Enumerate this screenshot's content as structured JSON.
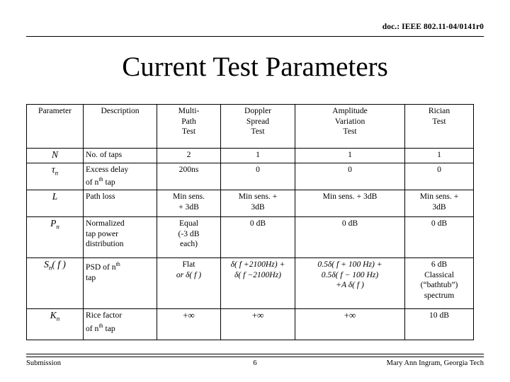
{
  "header": {
    "doc_id": "doc.: IEEE 802.11-04/0141r0"
  },
  "title": "Current Test Parameters",
  "table": {
    "columns": [
      {
        "key": "parameter",
        "label": "Parameter"
      },
      {
        "key": "description",
        "label": "Description"
      },
      {
        "key": "multipath",
        "label": "Multi-\nPath\nTest"
      },
      {
        "key": "doppler",
        "label": "Doppler\nSpread\nTest"
      },
      {
        "key": "amplitude",
        "label": "Amplitude\nVariation\nTest"
      },
      {
        "key": "rician",
        "label": "Rician\nTest"
      }
    ],
    "headers": {
      "parameter": "Parameter",
      "description": "Description",
      "multipath_l1": "Multi-",
      "multipath_l2": "Path",
      "multipath_l3": "Test",
      "doppler_l1": "Doppler",
      "doppler_l2": "Spread",
      "doppler_l3": "Test",
      "amplitude_l1": "Amplitude",
      "amplitude_l2": "Variation",
      "amplitude_l3": "Test",
      "rician_l1": "Rician",
      "rician_l2": "Test"
    },
    "rows": [
      {
        "symbol": "N",
        "symbol_sub": "",
        "description": "No. of taps",
        "multipath": "2",
        "doppler": "1",
        "amplitude": "1",
        "rician": "1"
      },
      {
        "symbol": "τ",
        "symbol_sub": "n",
        "description_a": "Excess delay",
        "description_b_pre": "of n",
        "description_b_sup": "th",
        "description_b_post": " tap",
        "multipath": "200ns",
        "doppler": "0",
        "amplitude": "0",
        "rician": "0"
      },
      {
        "symbol": "L",
        "symbol_sub": "",
        "description": "Path loss",
        "multipath_l1": "Min sens.",
        "multipath_l2": "+ 3dB",
        "doppler_l1": "Min sens. +",
        "doppler_l2": "3dB",
        "amplitude": "Min sens. + 3dB",
        "rician_l1": "Min sens. +",
        "rician_l2": "3dB"
      },
      {
        "symbol": "P",
        "symbol_sub": "n",
        "description_l1": "Normalized",
        "description_l2": "tap power",
        "description_l3": "distribution",
        "multipath_l1": "Equal",
        "multipath_l2": "(-3 dB",
        "multipath_l3": "each)",
        "doppler": "0 dB",
        "amplitude": "0 dB",
        "rician": "0 dB"
      },
      {
        "symbol": "S",
        "symbol_sub": "n",
        "symbol_arg": "( f )",
        "description_a_pre": "PSD of n",
        "description_a_sup": "th",
        "description_b": "tap",
        "multipath_l1": "Flat",
        "multipath_l2": "or  δ( f )",
        "doppler_l1": "δ( f +2100Hz) +",
        "doppler_l2": "δ( f −2100Hz)",
        "amplitude_l1": "0.5δ( f + 100 Hz) +",
        "amplitude_l2": "0.5δ( f − 100 Hz)",
        "amplitude_l3": "+A δ( f )",
        "rician_l1": "6 dB",
        "rician_l2": "Classical",
        "rician_l3": "(“bathtub”)",
        "rician_l4": "spectrum"
      },
      {
        "symbol": "K",
        "symbol_sub": "n",
        "description_a": "Rice factor",
        "description_b_pre": "of  n",
        "description_b_sup": "th",
        "description_b_post": " tap",
        "multipath": "+∞",
        "doppler": "+∞",
        "amplitude": "+∞",
        "rician": "10 dB"
      }
    ]
  },
  "footer": {
    "left": "Submission",
    "page": "6",
    "right": "Mary Ann Ingram, Georgia Tech"
  }
}
